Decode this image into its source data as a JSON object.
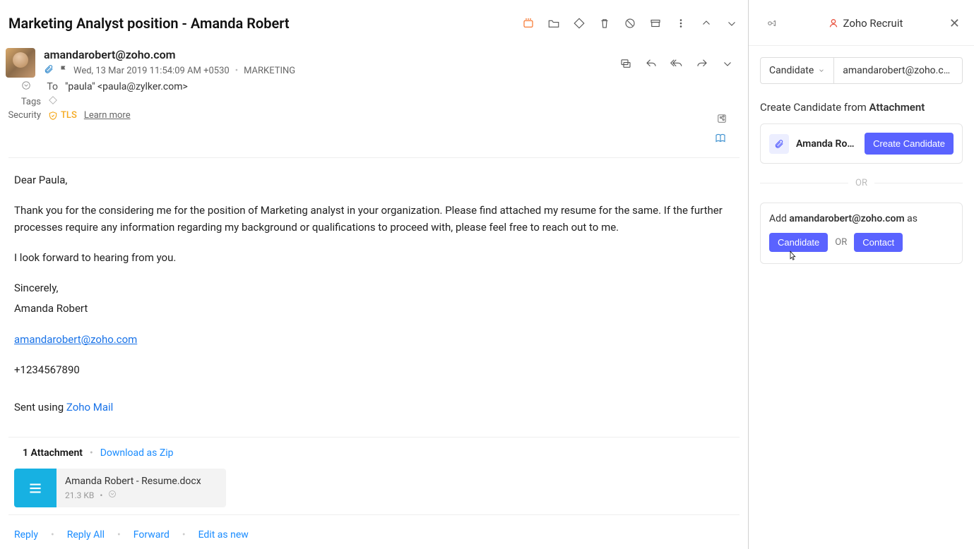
{
  "email": {
    "subject": "Marketing Analyst position - Amanda Robert",
    "from": "amandarobert@zoho.com",
    "date": "Wed, 13 Mar 2019 11:54:09 AM +0530",
    "category": "MARKETING",
    "to_label": "To",
    "to": "\"paula\" <paula@zylker.com>",
    "tags_label": "Tags",
    "security_label": "Security",
    "tls": "TLS",
    "learn_more": "Learn more",
    "body": {
      "greeting": "Dear Paula,",
      "p1": "Thank you for the considering me for the position of Marketing analyst in your organization. Please find attached my resume for the same. If the further processes require any information regarding my background or qualifications to proceed with, please feel free to reach out to me.",
      "p2": "I look forward to hearing from you.",
      "closing": "Sincerely,",
      "sig_name": "Amanda Robert",
      "sig_email": "amandarobert@zoho.com",
      "sig_phone": "+1234567890",
      "sent_using_prefix": "Sent using ",
      "sent_using_link": "Zoho Mail"
    },
    "attachment": {
      "count_label": "1 Attachment",
      "download_zip": "Download as Zip",
      "name": "Amanda Robert - Resume.docx",
      "size": "21.3 KB"
    },
    "actions": {
      "reply": "Reply",
      "reply_all": "Reply All",
      "forward": "Forward",
      "edit_as_new": "Edit as new"
    }
  },
  "panel": {
    "brand": "Zoho Recruit",
    "selector": {
      "type": "Candidate",
      "value": "amandarobert@zoho.com"
    },
    "create_title_pre": "Create Candidate from ",
    "create_title_bold": "Attachment",
    "att_name": "Amanda Robert - ...",
    "create_btn": "Create Candidate",
    "or": "OR",
    "add_prefix": "Add ",
    "add_email": "amandarobert@zoho.com",
    "add_suffix": " as",
    "btn_candidate": "Candidate",
    "btn_contact": "Contact"
  }
}
